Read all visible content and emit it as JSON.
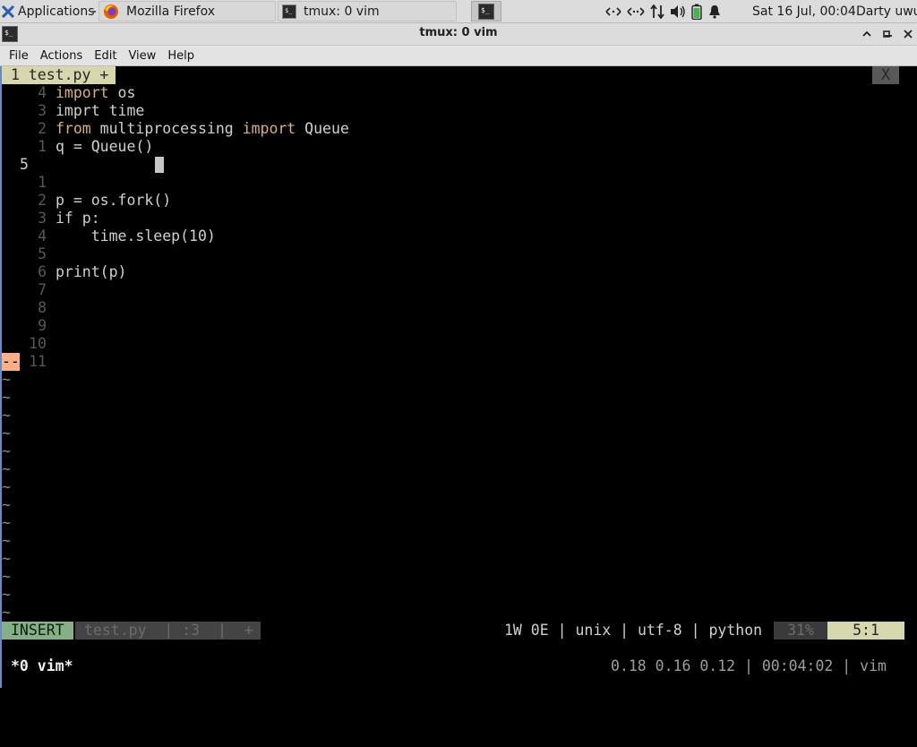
{
  "panel": {
    "applications": "Applications",
    "tasks": [
      {
        "title": "Mozilla Firefox",
        "icon": "firefox-icon"
      },
      {
        "title": "tmux: 0 vim",
        "icon": "terminal-icon"
      }
    ],
    "clock": "Sat 16 Jul, 00:04",
    "user": "Darty uwu"
  },
  "window": {
    "title": "tmux: 0 vim"
  },
  "menu": [
    "File",
    "Actions",
    "Edit",
    "View",
    "Help"
  ],
  "vim": {
    "tab_label": "1 test.py +",
    "tab_close": "X",
    "lines": [
      {
        "num": "4",
        "segments": [
          {
            "t": "import",
            "kw": true
          },
          {
            "t": " os"
          }
        ]
      },
      {
        "num": "3",
        "segments": [
          {
            "t": "imprt time"
          }
        ]
      },
      {
        "num": "2",
        "segments": [
          {
            "t": "from",
            "kw": true
          },
          {
            "t": " multiprocessing "
          },
          {
            "t": "import",
            "kw": true
          },
          {
            "t": " Queue"
          }
        ]
      },
      {
        "num": "1",
        "segments": [
          {
            "t": "q = Queue()"
          }
        ]
      },
      {
        "num": "5",
        "current": true,
        "segments": []
      },
      {
        "num": "1",
        "segments": []
      },
      {
        "num": "2",
        "segments": [
          {
            "t": "p = os.fork()"
          }
        ]
      },
      {
        "num": "3",
        "segments": [
          {
            "t": "if p:"
          }
        ]
      },
      {
        "num": "4",
        "segments": [
          {
            "t": "    time.sleep(10)"
          }
        ]
      },
      {
        "num": "5",
        "segments": []
      },
      {
        "num": "6",
        "segments": [
          {
            "t": "print(p)"
          }
        ]
      },
      {
        "num": "7",
        "segments": []
      },
      {
        "num": "8",
        "segments": []
      },
      {
        "num": "9",
        "segments": []
      },
      {
        "num": "10",
        "segments": []
      },
      {
        "num": "11",
        "mark": "--",
        "segments": []
      }
    ],
    "tilde_count": 14,
    "tilde_char": "~",
    "status": {
      "mode": "INSERT",
      "file": "test.py  | :3  |  +",
      "info": "1W 0E | unix | utf-8 | python",
      "percent": "31%",
      "position": "5:1"
    }
  },
  "tmux": {
    "window": "*0 vim*",
    "right": "0.18 0.16 0.12 | 00:04:02 | vim"
  }
}
